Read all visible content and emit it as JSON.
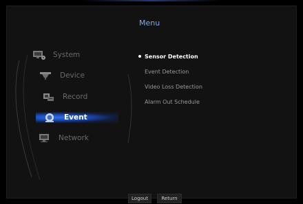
{
  "menu": {
    "title": "Menu"
  },
  "sidebar": {
    "items": [
      {
        "label": "System",
        "icon": "monitor-gear-icon"
      },
      {
        "label": "Device",
        "icon": "camera-icon"
      },
      {
        "label": "Record",
        "icon": "recorder-icon"
      },
      {
        "label": "Event",
        "icon": "event-icon",
        "active": true
      },
      {
        "label": "Network",
        "icon": "network-icon"
      }
    ]
  },
  "submenu": {
    "items": [
      {
        "label": "Sensor Detection",
        "selected": true
      },
      {
        "label": "Event Detection"
      },
      {
        "label": "Video Loss Detection"
      },
      {
        "label": "Alarm Out Schedule"
      }
    ]
  },
  "footer": {
    "logout_label": "Logout",
    "return_label": "Return"
  },
  "colors": {
    "accent": "#2e6fe0",
    "title": "#7fa8e8",
    "background": "#121212"
  }
}
